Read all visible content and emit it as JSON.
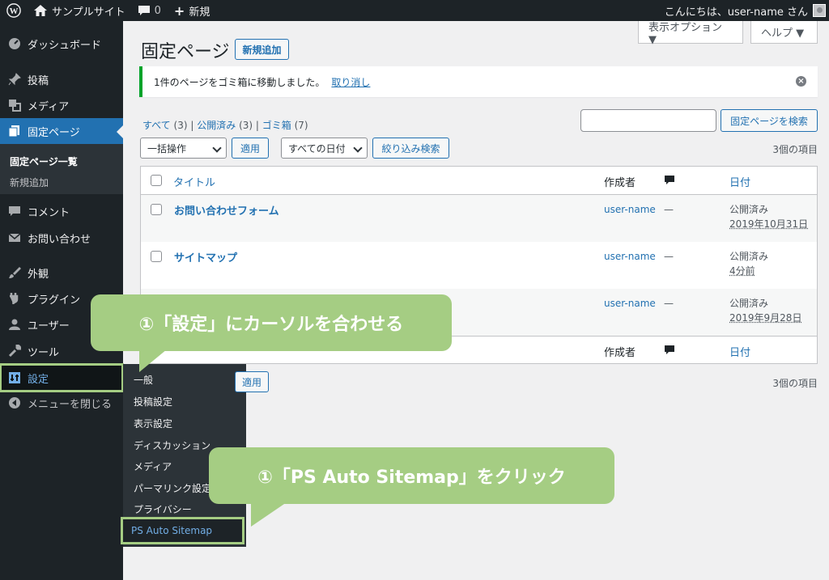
{
  "adminbar": {
    "site_name": "サンプルサイト",
    "comment_count": "0",
    "new_label": "新規",
    "greeting": "こんにちは、user-name さん"
  },
  "sidebar": {
    "items": [
      {
        "label": "ダッシュボード",
        "icon": "dashboard-icon"
      },
      {
        "label": "投稿",
        "icon": "pin-icon"
      },
      {
        "label": "メディア",
        "icon": "media-icon"
      },
      {
        "label": "固定ページ",
        "icon": "page-icon"
      },
      {
        "label": "コメント",
        "icon": "comment-icon"
      },
      {
        "label": "お問い合わせ",
        "icon": "mail-icon"
      },
      {
        "label": "外観",
        "icon": "brush-icon"
      },
      {
        "label": "プラグイン",
        "icon": "plugin-icon"
      },
      {
        "label": "ユーザー",
        "icon": "user-icon"
      },
      {
        "label": "ツール",
        "icon": "wrench-icon"
      },
      {
        "label": "設定",
        "icon": "settings-icon"
      },
      {
        "label": "メニューを閉じる",
        "icon": "collapse-icon"
      }
    ],
    "submenu": [
      "固定ページ一覧",
      "新規追加"
    ]
  },
  "flyout": [
    "一般",
    "投稿設定",
    "表示設定",
    "ディスカッション",
    "メディア",
    "パーマリンク設定",
    "プライバシー",
    "PS Auto Sitemap"
  ],
  "screen_options": "表示オプション ▼",
  "help": "ヘルプ ▼",
  "page_title": "固定ページ",
  "add_new": "新規追加",
  "notice": {
    "text": "1件のページをゴミ箱に移動しました。",
    "undo": "取り消し"
  },
  "views": {
    "all": "すべて",
    "all_count": "(3)",
    "published": "公開済み",
    "published_count": "(3)",
    "trash": "ゴミ箱",
    "trash_count": "(7)",
    "sep": "|"
  },
  "search_button": "固定ページを検索",
  "bulk": {
    "select": "一括操作",
    "apply": "適用",
    "dates": "すべての日付",
    "filter": "絞り込み検索"
  },
  "items_count": "3個の項目",
  "table": {
    "col_title": "タイトル",
    "col_author": "作成者",
    "col_date": "日付",
    "rows": [
      {
        "title": "お問い合わせフォーム",
        "author": "user-name",
        "comments": "—",
        "status": "公開済み",
        "date": "2019年10月31日"
      },
      {
        "title": "サイトマップ",
        "author": "user-name",
        "comments": "—",
        "status": "公開済み",
        "date": "4分前"
      },
      {
        "title": "",
        "author": "user-name",
        "comments": "—",
        "status": "公開済み",
        "date": "2019年9月28日"
      }
    ]
  },
  "callouts": {
    "one": "①「設定」にカーソルを合わせる",
    "two": "①「PS Auto Sitemap」をクリック"
  },
  "colors": {
    "accent": "#2271b1",
    "callout": "#a5cd83",
    "bar": "#1d2327"
  }
}
